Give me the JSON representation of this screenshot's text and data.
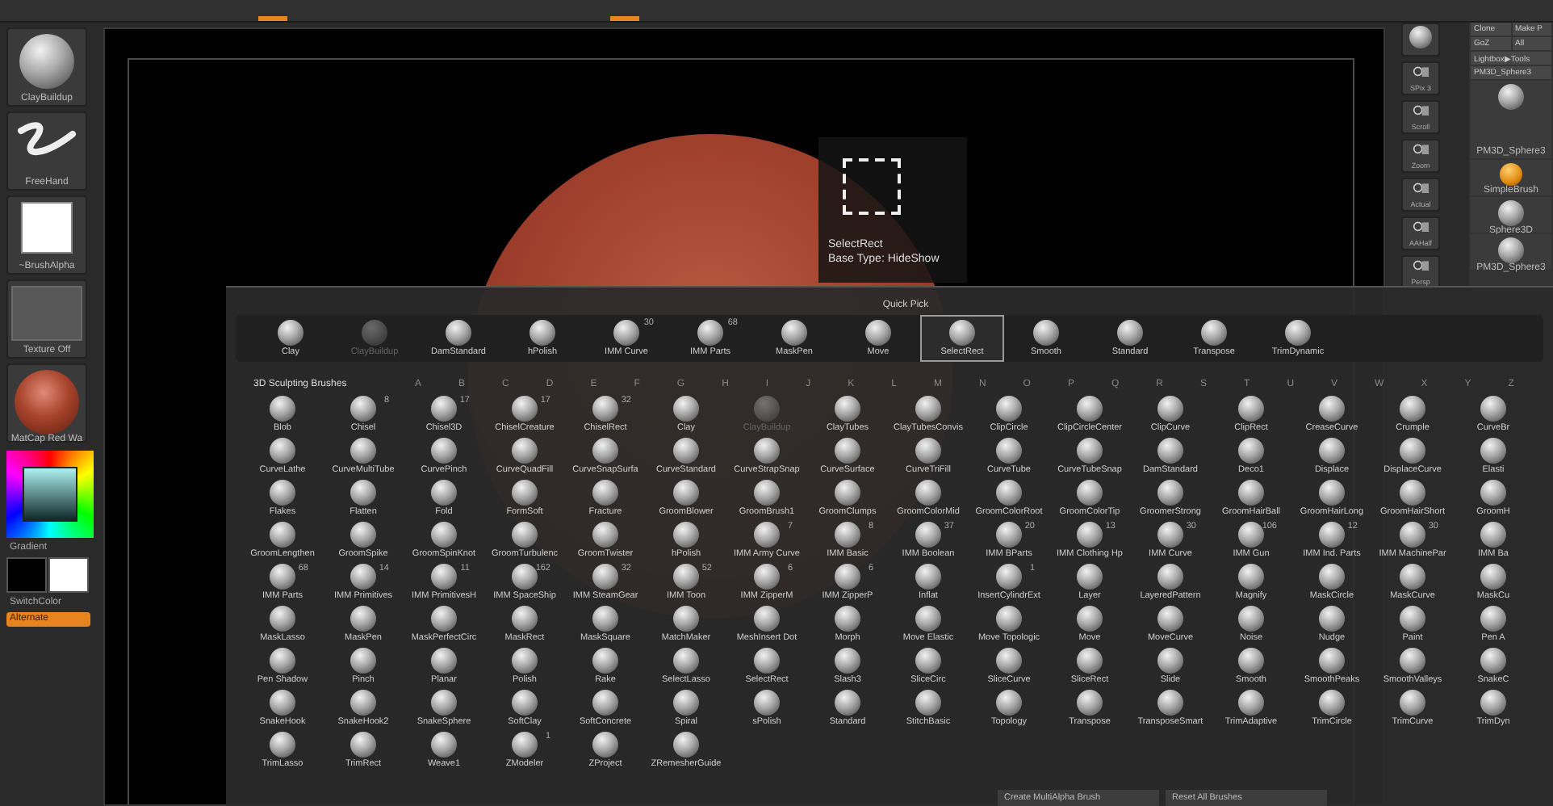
{
  "left_shelf": {
    "items": [
      {
        "kind": "brush",
        "label": "ClayBuildup"
      },
      {
        "kind": "stroke",
        "label": "FreeHand"
      },
      {
        "kind": "alpha",
        "label": "~BrushAlpha"
      },
      {
        "kind": "texture",
        "label": "Texture Off"
      },
      {
        "kind": "material",
        "label": "MatCap Red Wa"
      }
    ],
    "gradient_label": "Gradient",
    "switch_label": "SwitchColor",
    "alternate_button": "Alternate"
  },
  "canvas": {
    "tooltip": {
      "title": "SelectRect",
      "subtitle": "Base Type: HideShow"
    }
  },
  "right_shelf": [
    "SPix 3",
    "Scroll",
    "Zoom",
    "Actual",
    "AAHalf",
    "Persp"
  ],
  "tool_panel": {
    "buttons": [
      "Clone",
      "Make P",
      "GoZ",
      "All",
      "Lightbox▶Tools"
    ],
    "current_tool": "PM3D_Sphere3",
    "tools": [
      {
        "kind": "sphere",
        "label": "PM3D_Sphere3"
      },
      {
        "kind": "simple",
        "label": "SimpleBrush"
      },
      {
        "kind": "sphere",
        "label": "Sphere3D"
      },
      {
        "kind": "sphere",
        "label": "PM3D_Sphere3"
      }
    ]
  },
  "brush_palette": {
    "quick_pick_title": "Quick Pick",
    "quick_pick": [
      {
        "name": "Clay",
        "selected": false,
        "dimmed": false
      },
      {
        "name": "ClayBuildup",
        "selected": false,
        "dimmed": true
      },
      {
        "name": "DamStandard",
        "selected": false,
        "dimmed": false
      },
      {
        "name": "hPolish",
        "selected": false,
        "dimmed": false
      },
      {
        "name": "IMM Curve",
        "count": "30",
        "selected": false,
        "dimmed": false
      },
      {
        "name": "IMM Parts",
        "count": "68",
        "selected": false,
        "dimmed": false
      },
      {
        "name": "MaskPen",
        "selected": false,
        "dimmed": false
      },
      {
        "name": "Move",
        "selected": false,
        "dimmed": false
      },
      {
        "name": "SelectRect",
        "selected": true,
        "dimmed": false
      },
      {
        "name": "Smooth",
        "selected": false,
        "dimmed": false
      },
      {
        "name": "Standard",
        "selected": false,
        "dimmed": false
      },
      {
        "name": "Transpose",
        "selected": false,
        "dimmed": false
      },
      {
        "name": "TrimDynamic",
        "selected": false,
        "dimmed": false
      }
    ],
    "section_title": "3D Sculpting Brushes",
    "letters": [
      "A",
      "B",
      "C",
      "D",
      "E",
      "F",
      "G",
      "H",
      "I",
      "J",
      "K",
      "L",
      "M",
      "N",
      "O",
      "P",
      "Q",
      "R",
      "S",
      "T",
      "U",
      "V",
      "W",
      "X",
      "Y",
      "Z"
    ],
    "brushes": [
      {
        "name": "Blob",
        "dimmed": false
      },
      {
        "name": "Chisel",
        "count": "8",
        "dimmed": false
      },
      {
        "name": "Chisel3D",
        "count": "17",
        "dimmed": false
      },
      {
        "name": "ChiselCreature",
        "count": "17",
        "dimmed": false
      },
      {
        "name": "ChiselRect",
        "count": "32",
        "dimmed": false
      },
      {
        "name": "Clay",
        "dimmed": false
      },
      {
        "name": "ClayBuildup",
        "dimmed": true
      },
      {
        "name": "ClayTubes",
        "dimmed": false
      },
      {
        "name": "ClayTubesConvis",
        "dimmed": false
      },
      {
        "name": "ClipCircle",
        "dimmed": false
      },
      {
        "name": "ClipCircleCenter",
        "dimmed": false
      },
      {
        "name": "ClipCurve",
        "dimmed": false
      },
      {
        "name": "ClipRect",
        "dimmed": false
      },
      {
        "name": "CreaseCurve",
        "dimmed": false
      },
      {
        "name": "Crumple",
        "dimmed": false
      },
      {
        "name": "CurveBr",
        "dimmed": false
      },
      {
        "name": "CurveLathe",
        "dimmed": false
      },
      {
        "name": "CurveMultiTube",
        "dimmed": false
      },
      {
        "name": "CurvePinch",
        "dimmed": false
      },
      {
        "name": "CurveQuadFill",
        "dimmed": false
      },
      {
        "name": "CurveSnapSurfa",
        "dimmed": false
      },
      {
        "name": "CurveStandard",
        "dimmed": false
      },
      {
        "name": "CurveStrapSnap",
        "dimmed": false
      },
      {
        "name": "CurveSurface",
        "dimmed": false
      },
      {
        "name": "CurveTriFill",
        "dimmed": false
      },
      {
        "name": "CurveTube",
        "dimmed": false
      },
      {
        "name": "CurveTubeSnap",
        "dimmed": false
      },
      {
        "name": "DamStandard",
        "dimmed": false
      },
      {
        "name": "Deco1",
        "dimmed": false
      },
      {
        "name": "Displace",
        "dimmed": false
      },
      {
        "name": "DisplaceCurve",
        "dimmed": false
      },
      {
        "name": "Elasti",
        "dimmed": false
      },
      {
        "name": "Flakes",
        "dimmed": false
      },
      {
        "name": "Flatten",
        "dimmed": false
      },
      {
        "name": "Fold",
        "dimmed": false
      },
      {
        "name": "FormSoft",
        "dimmed": false
      },
      {
        "name": "Fracture",
        "dimmed": false
      },
      {
        "name": "GroomBlower",
        "dimmed": false
      },
      {
        "name": "GroomBrush1",
        "dimmed": false
      },
      {
        "name": "GroomClumps",
        "dimmed": false
      },
      {
        "name": "GroomColorMid",
        "dimmed": false
      },
      {
        "name": "GroomColorRoot",
        "dimmed": false
      },
      {
        "name": "GroomColorTip",
        "dimmed": false
      },
      {
        "name": "GroomerStrong",
        "dimmed": false
      },
      {
        "name": "GroomHairBall",
        "dimmed": false
      },
      {
        "name": "GroomHairLong",
        "dimmed": false
      },
      {
        "name": "GroomHairShort",
        "dimmed": false
      },
      {
        "name": "GroomH",
        "dimmed": false
      },
      {
        "name": "GroomLengthen",
        "dimmed": false
      },
      {
        "name": "GroomSpike",
        "dimmed": false
      },
      {
        "name": "GroomSpinKnot",
        "dimmed": false
      },
      {
        "name": "GroomTurbulenc",
        "dimmed": false
      },
      {
        "name": "GroomTwister",
        "dimmed": false
      },
      {
        "name": "hPolish",
        "dimmed": false
      },
      {
        "name": "IMM Army Curve",
        "count": "7",
        "dimmed": false
      },
      {
        "name": "IMM Basic",
        "count": "8",
        "dimmed": false
      },
      {
        "name": "IMM Boolean",
        "count": "37",
        "dimmed": false
      },
      {
        "name": "IMM BParts",
        "count": "20",
        "dimmed": false
      },
      {
        "name": "IMM Clothing Hp",
        "count": "13",
        "dimmed": false
      },
      {
        "name": "IMM Curve",
        "count": "30",
        "dimmed": false
      },
      {
        "name": "IMM Gun",
        "count": "106",
        "dimmed": false
      },
      {
        "name": "IMM Ind. Parts",
        "count": "12",
        "dimmed": false
      },
      {
        "name": "IMM MachinePar",
        "count": "30",
        "dimmed": false
      },
      {
        "name": "IMM Ba",
        "dimmed": false
      },
      {
        "name": "IMM Parts",
        "count": "68",
        "dimmed": false
      },
      {
        "name": "IMM Primitives",
        "count": "14",
        "dimmed": false
      },
      {
        "name": "IMM PrimitivesH",
        "count": "11",
        "dimmed": false
      },
      {
        "name": "IMM SpaceShip",
        "count": "162",
        "dimmed": false
      },
      {
        "name": "IMM SteamGear",
        "count": "32",
        "dimmed": false
      },
      {
        "name": "IMM Toon",
        "count": "52",
        "dimmed": false
      },
      {
        "name": "IMM ZipperM",
        "count": "6",
        "dimmed": false
      },
      {
        "name": "IMM ZipperP",
        "count": "6",
        "dimmed": false
      },
      {
        "name": "Inflat",
        "dimmed": false
      },
      {
        "name": "InsertCylindrExt",
        "count": "1",
        "dimmed": false
      },
      {
        "name": "Layer",
        "dimmed": false
      },
      {
        "name": "LayeredPattern",
        "dimmed": false
      },
      {
        "name": "Magnify",
        "dimmed": false
      },
      {
        "name": "MaskCircle",
        "dimmed": false
      },
      {
        "name": "MaskCurve",
        "dimmed": false
      },
      {
        "name": "MaskCu",
        "dimmed": false
      },
      {
        "name": "MaskLasso",
        "dimmed": false
      },
      {
        "name": "MaskPen",
        "dimmed": false
      },
      {
        "name": "MaskPerfectCirc",
        "dimmed": false
      },
      {
        "name": "MaskRect",
        "dimmed": false
      },
      {
        "name": "MaskSquare",
        "dimmed": false
      },
      {
        "name": "MatchMaker",
        "dimmed": false
      },
      {
        "name": "MeshInsert Dot",
        "dimmed": false
      },
      {
        "name": "Morph",
        "dimmed": false
      },
      {
        "name": "Move Elastic",
        "dimmed": false
      },
      {
        "name": "Move Topologic",
        "dimmed": false
      },
      {
        "name": "Move",
        "dimmed": false
      },
      {
        "name": "MoveCurve",
        "dimmed": false
      },
      {
        "name": "Noise",
        "dimmed": false
      },
      {
        "name": "Nudge",
        "dimmed": false
      },
      {
        "name": "Paint",
        "dimmed": false
      },
      {
        "name": "Pen A",
        "dimmed": false
      },
      {
        "name": "Pen Shadow",
        "dimmed": false
      },
      {
        "name": "Pinch",
        "dimmed": false
      },
      {
        "name": "Planar",
        "dimmed": false
      },
      {
        "name": "Polish",
        "dimmed": false
      },
      {
        "name": "Rake",
        "dimmed": false
      },
      {
        "name": "SelectLasso",
        "dimmed": false
      },
      {
        "name": "SelectRect",
        "dimmed": false
      },
      {
        "name": "Slash3",
        "dimmed": false
      },
      {
        "name": "SliceCirc",
        "dimmed": false
      },
      {
        "name": "SliceCurve",
        "dimmed": false
      },
      {
        "name": "SliceRect",
        "dimmed": false
      },
      {
        "name": "Slide",
        "dimmed": false
      },
      {
        "name": "Smooth",
        "dimmed": false
      },
      {
        "name": "SmoothPeaks",
        "dimmed": false
      },
      {
        "name": "SmoothValleys",
        "dimmed": false
      },
      {
        "name": "SnakeC",
        "dimmed": false
      },
      {
        "name": "SnakeHook",
        "dimmed": false
      },
      {
        "name": "SnakeHook2",
        "dimmed": false
      },
      {
        "name": "SnakeSphere",
        "dimmed": false
      },
      {
        "name": "SoftClay",
        "dimmed": false
      },
      {
        "name": "SoftConcrete",
        "dimmed": false
      },
      {
        "name": "Spiral",
        "dimmed": false
      },
      {
        "name": "sPolish",
        "dimmed": false
      },
      {
        "name": "Standard",
        "dimmed": false
      },
      {
        "name": "StitchBasic",
        "dimmed": false
      },
      {
        "name": "Topology",
        "dimmed": false
      },
      {
        "name": "Transpose",
        "dimmed": false
      },
      {
        "name": "TransposeSmart",
        "dimmed": false
      },
      {
        "name": "TrimAdaptive",
        "dimmed": false
      },
      {
        "name": "TrimCircle",
        "dimmed": false
      },
      {
        "name": "TrimCurve",
        "dimmed": false
      },
      {
        "name": "TrimDyn",
        "dimmed": false
      },
      {
        "name": "TrimLasso",
        "dimmed": false
      },
      {
        "name": "TrimRect",
        "dimmed": false
      },
      {
        "name": "Weave1",
        "dimmed": false
      },
      {
        "name": "ZModeler",
        "count": "1",
        "dimmed": false
      },
      {
        "name": "ZProject",
        "dimmed": false
      },
      {
        "name": "ZRemesherGuide",
        "dimmed": false
      }
    ],
    "buttons": [
      "Create MultiAlpha Brush",
      "Reset All Brushes"
    ]
  }
}
